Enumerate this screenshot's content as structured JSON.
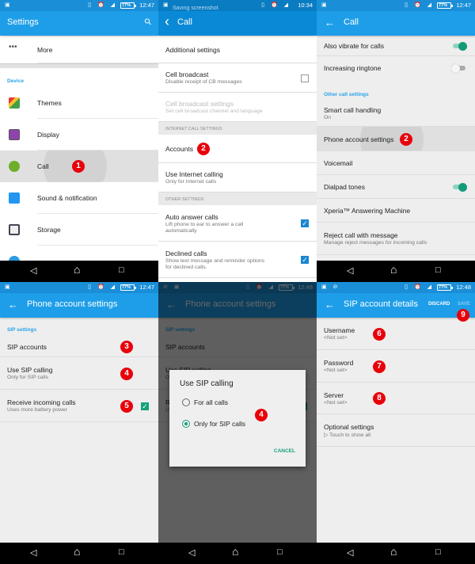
{
  "accent_color": "#1e9ee8",
  "badge_color": "#e8000b",
  "panels": [
    {
      "status": {
        "time": "12:47",
        "battery": "77%"
      },
      "title": "Settings",
      "has_search": true,
      "rows": [
        {
          "type": "row",
          "label": "More",
          "icon": "more-icon"
        },
        {
          "type": "gap"
        },
        {
          "type": "header",
          "label": "Device"
        },
        {
          "type": "row",
          "label": "Themes",
          "icon": "themes-icon"
        },
        {
          "type": "row",
          "label": "Display",
          "icon": "display-icon"
        },
        {
          "type": "row",
          "label": "Call",
          "icon": "call-icon",
          "highlight": true,
          "badge": "1"
        },
        {
          "type": "row",
          "label": "Sound & notification",
          "icon": "sound-icon"
        },
        {
          "type": "row",
          "label": "Storage",
          "icon": "storage-icon"
        },
        {
          "type": "row",
          "label": "",
          "icon": "power-icon"
        }
      ]
    },
    {
      "status": {
        "time": "10:34",
        "note": "Saving screenshot"
      },
      "title": "Call",
      "back_style": "chevron",
      "rows": [
        {
          "type": "row",
          "label": "Additional settings"
        },
        {
          "type": "row",
          "label": "Cell broadcast",
          "sub": "Disable receipt of CB messages",
          "control": "checkbox",
          "checked": false
        },
        {
          "type": "row",
          "label": "Cell broadcast settings",
          "sub": "Set cell broadcast channel and language",
          "disabled": true
        },
        {
          "type": "header_gray",
          "label": "INTERNET CALL SETTINGS"
        },
        {
          "type": "row",
          "label": "Accounts",
          "badge": "2"
        },
        {
          "type": "row",
          "label": "Use Internet calling",
          "sub": "Only for Internet calls"
        },
        {
          "type": "header_gray",
          "label": "OTHER SETTINGS"
        },
        {
          "type": "row",
          "label": "Auto answer calls",
          "sub": "Lift phone to ear to answer a call",
          "sub2": "automatically",
          "control": "checkbox",
          "checked": true
        },
        {
          "type": "row",
          "label": "Declined calls",
          "sub": "Show text message and reminder options",
          "sub2": "for declined calls.",
          "control": "checkbox",
          "checked": true
        }
      ]
    },
    {
      "status": {
        "time": "12:47",
        "battery": "77%"
      },
      "title": "Call",
      "rows": [
        {
          "type": "row",
          "label": "Also vibrate for calls",
          "control": "switch",
          "checked": true
        },
        {
          "type": "row",
          "label": "Increasing ringtone",
          "control": "switch",
          "checked": false,
          "nodiv": true
        },
        {
          "type": "header",
          "label": "Other call settings"
        },
        {
          "type": "row",
          "label": "Smart call handling",
          "sub": "On"
        },
        {
          "type": "row",
          "label": "Phone account settings",
          "highlight": true,
          "badge": "2"
        },
        {
          "type": "row",
          "label": "Voicemail"
        },
        {
          "type": "row",
          "label": "Dialpad tones",
          "control": "switch",
          "checked": true
        },
        {
          "type": "row",
          "label": "Xperia™ Answering Machine"
        },
        {
          "type": "row",
          "label": "Reject call with message",
          "sub": "Manage reject messages for incoming calls"
        }
      ]
    },
    {
      "status": {
        "time": "12:47",
        "battery": "77%"
      },
      "title": "Phone account settings",
      "rows": [
        {
          "type": "header",
          "label": "SIP settings"
        },
        {
          "type": "row",
          "label": "SIP accounts",
          "badge": "3"
        },
        {
          "type": "row",
          "label": "Use SIP calling",
          "sub": "Only for SIP calls",
          "badge": "4"
        },
        {
          "type": "row",
          "label": "Receive incoming calls",
          "sub": "Uses more battery power",
          "control": "checkbox_teal",
          "checked": true,
          "badge": "5"
        }
      ]
    },
    {
      "status": {
        "time": "12:48",
        "battery": "77%"
      },
      "title": "Phone account settings",
      "rows": [
        {
          "type": "header",
          "label": "SIP settings"
        },
        {
          "type": "row",
          "label": "SIP accounts"
        },
        {
          "type": "row",
          "label": "Use SIP calling",
          "sub": "Only for SIP calls"
        },
        {
          "type": "row",
          "label": "Receive incoming calls",
          "sub": "Uses more battery power",
          "control": "checkbox_teal",
          "checked": true
        }
      ],
      "dialog": {
        "title": "Use SIP calling",
        "options": [
          {
            "label": "For all calls",
            "selected": false
          },
          {
            "label": "Only for SIP calls",
            "selected": true
          }
        ],
        "cancel": "CANCEL",
        "badge": "4"
      }
    },
    {
      "status": {
        "time": "12:48",
        "battery": "77%"
      },
      "title": "SIP account details",
      "actions": {
        "discard": "DISCARD",
        "save": "SAVE",
        "save_badge": "9"
      },
      "rows": [
        {
          "type": "row",
          "label": "Username",
          "sub": "<Not set>",
          "badge": "6"
        },
        {
          "type": "row",
          "label": "Password",
          "sub": "<Not set>",
          "badge": "7"
        },
        {
          "type": "row",
          "label": "Server",
          "sub": "<Not set>",
          "badge": "8"
        },
        {
          "type": "row",
          "label": "Optional settings",
          "sub": "▷ Touch to show all"
        }
      ]
    }
  ]
}
